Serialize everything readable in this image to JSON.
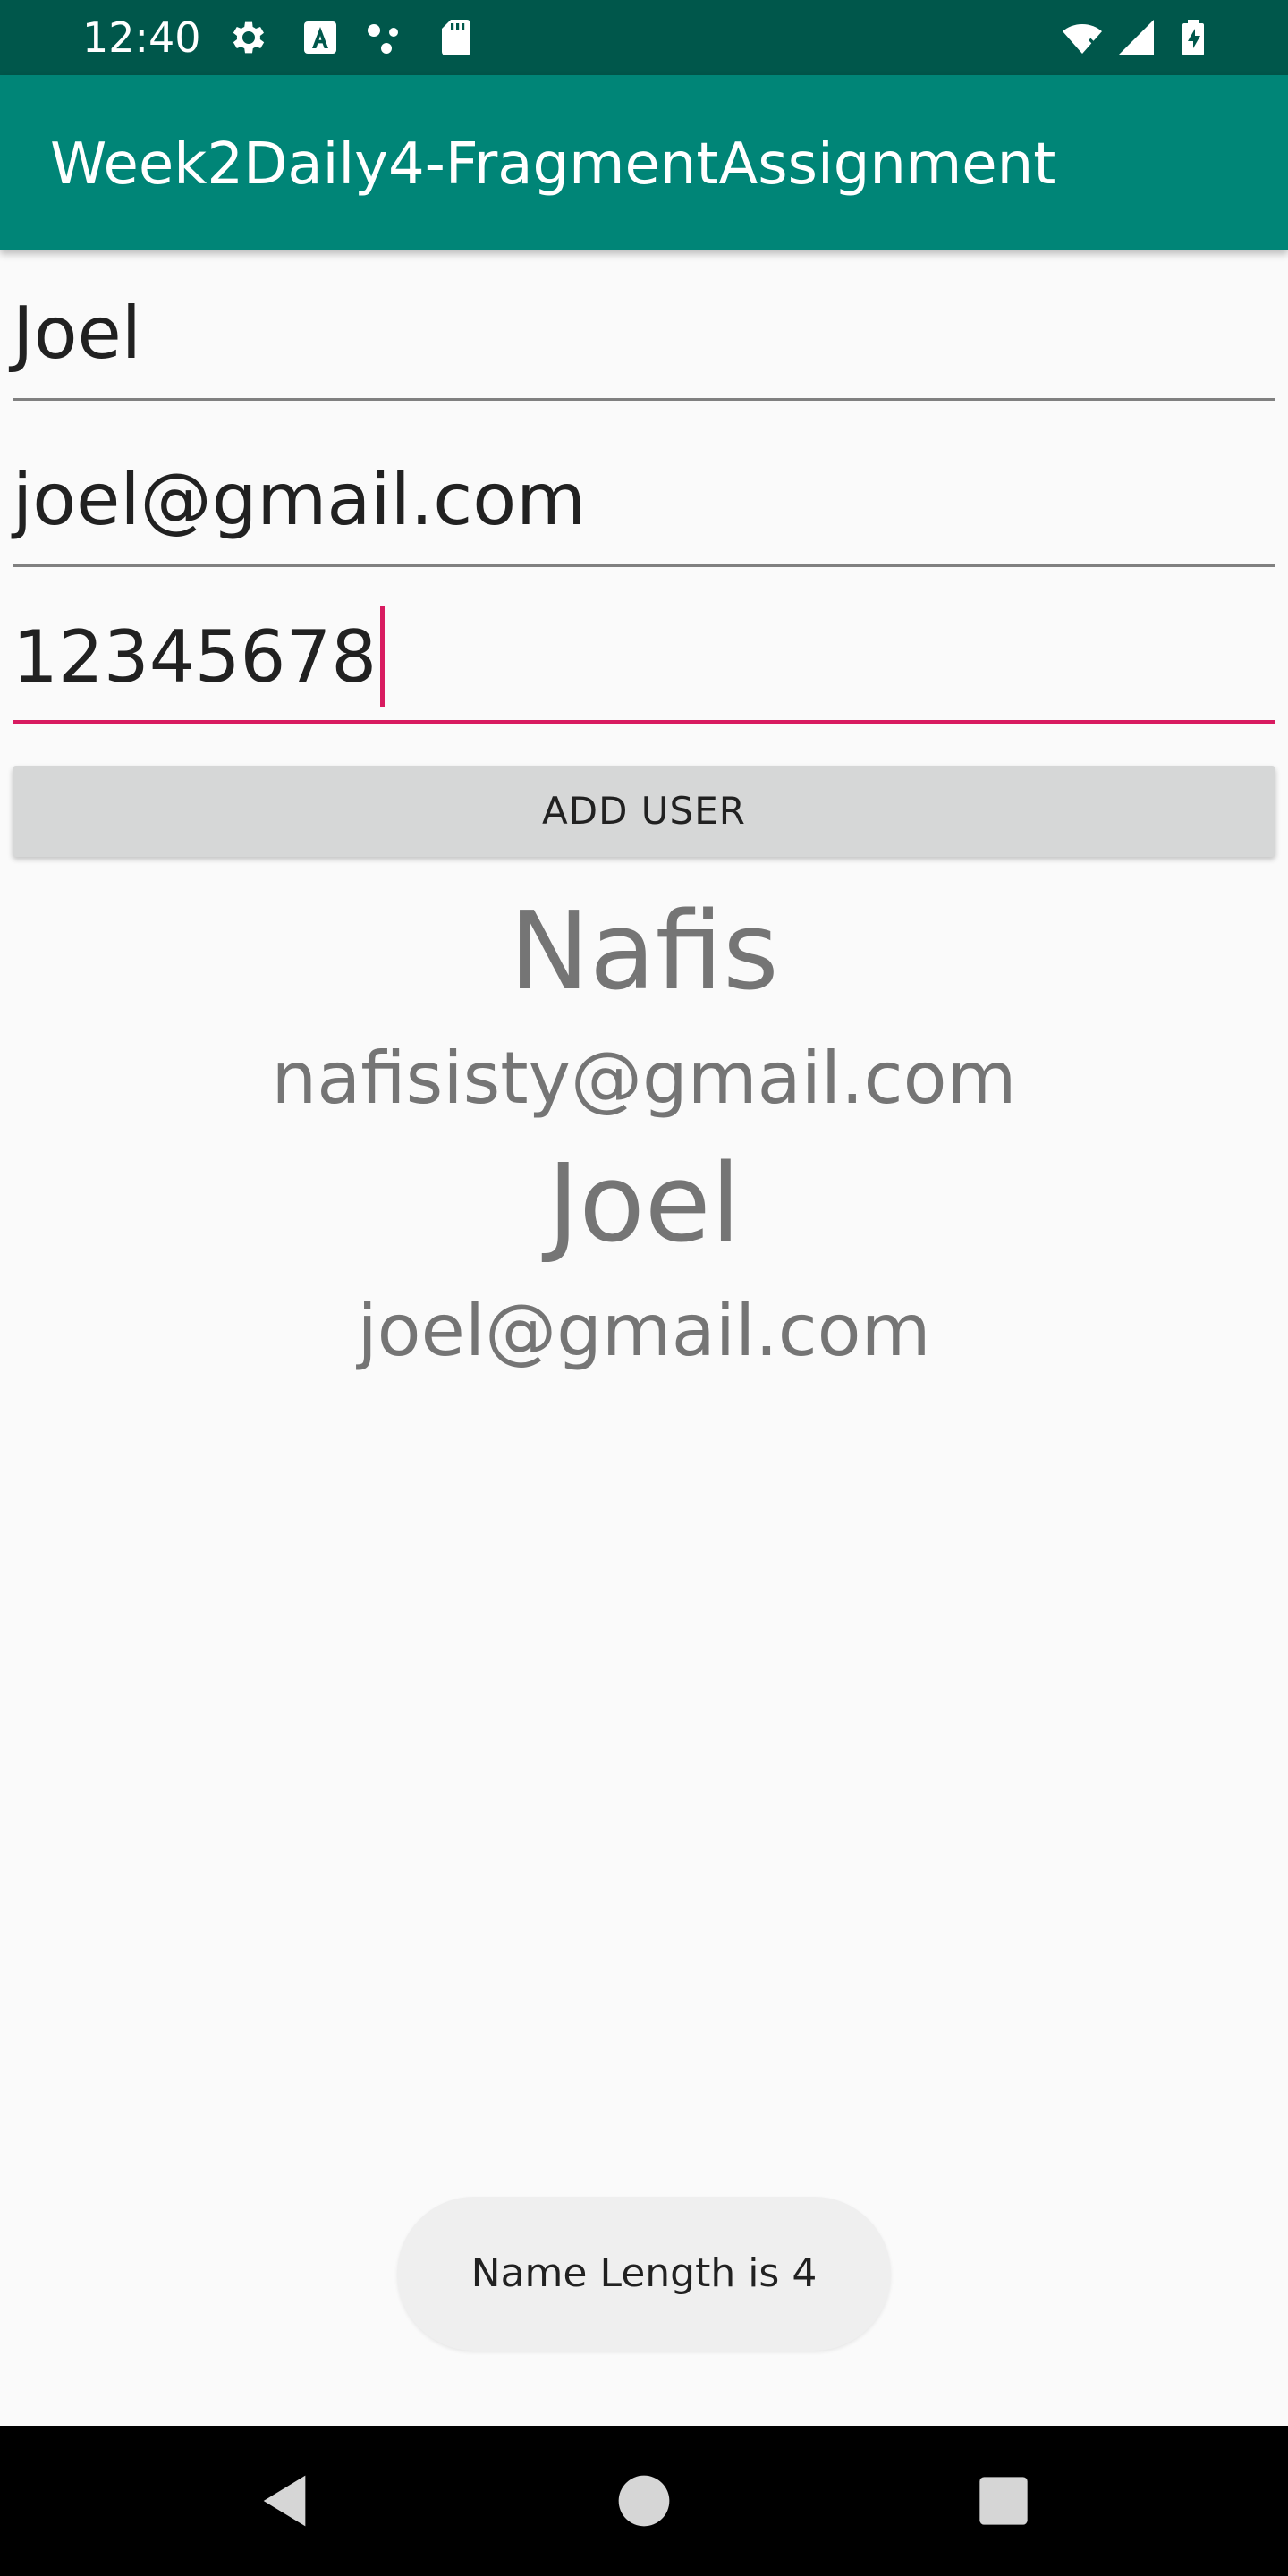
{
  "status_bar": {
    "time": "12:40",
    "icons": [
      "settings-icon",
      "a-notification-icon",
      "dots-icon",
      "sd-card-icon",
      "wifi-icon",
      "signal-icon",
      "battery-icon"
    ]
  },
  "app_bar": {
    "title": "Week2Daily4-FragmentAssignment",
    "color": "#008577",
    "status_color": "#00574b"
  },
  "form": {
    "name_value": "Joel",
    "email_value": "joel@gmail.com",
    "phone_value": "12345678",
    "focus_color": "#d81b60"
  },
  "add_button": {
    "label": "ADD USER"
  },
  "users": [
    {
      "name": "Nafis",
      "email": "nafisisty@gmail.com"
    },
    {
      "name": "Joel",
      "email": "joel@gmail.com"
    }
  ],
  "toast": {
    "text": "Name Length is 4"
  },
  "nav_bar": {
    "icons": [
      "back-icon",
      "home-icon",
      "recents-icon"
    ]
  }
}
